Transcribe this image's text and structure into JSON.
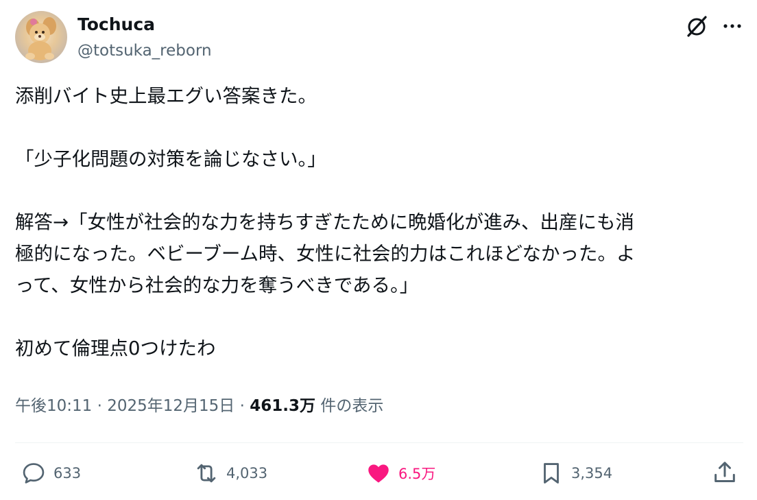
{
  "author": {
    "display_name": "Tochuca",
    "handle": "@totsuka_reborn",
    "avatar_icon": "plush-toy-avatar"
  },
  "header_icons": {
    "grok": "grok-icon",
    "more": "more-icon"
  },
  "tweet": {
    "lines": [
      "添削バイト史上最エグい答案きた。",
      "",
      "「少子化問題の対策を論じなさい。」",
      "",
      "解答→「女性が社会的な力を持ちすぎたために晩婚化が進み、出産にも消",
      "極的になった。ベビーブーム時、女性に社会的力はこれほどなかった。よ",
      "って、女性から社会的な力を奪うべきである。」",
      "",
      "初めて倫理点0つけたわ"
    ]
  },
  "meta": {
    "time": "午後10:11",
    "date": "2025年12月15日",
    "separator": "·",
    "views_count": "461.3万",
    "views_label": "件の表示"
  },
  "actions": {
    "reply": {
      "icon": "reply-icon",
      "count": "633"
    },
    "repost": {
      "icon": "repost-icon",
      "count": "4,033"
    },
    "like": {
      "icon": "heart-icon",
      "count": "6.5万",
      "liked": true,
      "color": "#f91880"
    },
    "bookmark": {
      "icon": "bookmark-icon",
      "count": "3,354"
    },
    "share": {
      "icon": "share-icon"
    }
  },
  "colors": {
    "text_primary": "#0f1419",
    "text_secondary": "#536471",
    "like_active": "#f91880",
    "divider": "#eff3f4"
  }
}
